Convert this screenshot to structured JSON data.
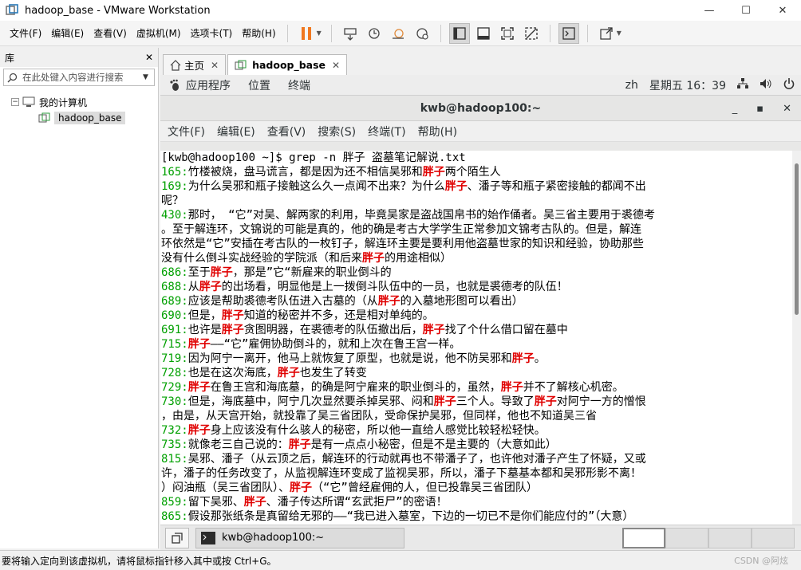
{
  "window": {
    "title": "hadoop_base - VMware Workstation"
  },
  "menu": [
    "文件(F)",
    "编辑(E)",
    "查看(V)",
    "虚拟机(M)",
    "选项卡(T)",
    "帮助(H)"
  ],
  "library": {
    "title": "库",
    "search_placeholder": "在此处键入内容进行搜索",
    "root": "我的计算机",
    "child": "hadoop_base"
  },
  "tabs": [
    {
      "label": "主页"
    },
    {
      "label": "hadoop_base"
    }
  ],
  "guest_bar": {
    "apps": "应用程序",
    "places": "位置",
    "terminal": "终端",
    "lang": "zh",
    "clock": "星期五 16：39"
  },
  "terminal": {
    "title": "kwb@hadoop100:~",
    "menu": [
      "文件(F)",
      "编辑(E)",
      "查看(V)",
      "搜索(S)",
      "终端(T)",
      "帮助(H)"
    ],
    "lines": [
      {
        "num": "",
        "segs": [
          {
            "t": "[kwb@hadoop100 ~]$ grep -n 胖子 盗墓笔记解说.txt"
          }
        ]
      },
      {
        "num": "165:",
        "segs": [
          {
            "t": "竹楼被烧，盘马谎言，都是因为还不相信吴邪和"
          },
          {
            "t": "胖子",
            "h": true
          },
          {
            "t": "两个陌生人"
          }
        ]
      },
      {
        "num": "169:",
        "segs": [
          {
            "t": "为什么吴邪和瓶子接触这么久一点闻不出来？为什么"
          },
          {
            "t": "胖子",
            "h": true
          },
          {
            "t": "、潘子等和瓶子紧密接触的都闻不出"
          }
        ]
      },
      {
        "num": "",
        "segs": [
          {
            "t": "呢？"
          }
        ]
      },
      {
        "num": "430:",
        "segs": [
          {
            "t": "那时，  “它”对吴、解两家的利用，毕竟吴家是盗战国帛书的始作俑者。吴三省主要用于裘德考"
          }
        ]
      },
      {
        "num": "",
        "segs": [
          {
            "t": "。至于解连环，文锦说的可能是真的，他的确是考古大学学生正常参加文锦考古队的。但是，解连"
          }
        ]
      },
      {
        "num": "",
        "segs": [
          {
            "t": "环依然是“它”安插在考古队的一枚钉子，解连环主要是要利用他盗墓世家的知识和经验，协助那些"
          }
        ]
      },
      {
        "num": "",
        "segs": [
          {
            "t": "没有什么倒斗实战经验的学院派（和后来"
          },
          {
            "t": "胖子",
            "h": true
          },
          {
            "t": "的用途相似）"
          }
        ]
      },
      {
        "num": "686:",
        "segs": [
          {
            "t": "至于"
          },
          {
            "t": "胖子",
            "h": true
          },
          {
            "t": "，那是”它“新雇来的职业倒斗的"
          }
        ]
      },
      {
        "num": "688:",
        "segs": [
          {
            "t": "从"
          },
          {
            "t": "胖子",
            "h": true
          },
          {
            "t": "的出场看，明显他是上一拨倒斗队伍中的一员，也就是裘德考的队伍！"
          }
        ]
      },
      {
        "num": "689:",
        "segs": [
          {
            "t": "应该是帮助裘德考队伍进入古墓的（从"
          },
          {
            "t": "胖子",
            "h": true
          },
          {
            "t": "的入墓地形图可以看出）"
          }
        ]
      },
      {
        "num": "690:",
        "segs": [
          {
            "t": "但是，"
          },
          {
            "t": "胖子",
            "h": true
          },
          {
            "t": "知道的秘密并不多，还是相对单纯的。"
          }
        ]
      },
      {
        "num": "691:",
        "segs": [
          {
            "t": "也许是"
          },
          {
            "t": "胖子",
            "h": true
          },
          {
            "t": "贪图明器，在裘德考的队伍撤出后，"
          },
          {
            "t": "胖子",
            "h": true
          },
          {
            "t": "找了个什么借口留在墓中"
          }
        ]
      },
      {
        "num": "715:",
        "segs": [
          {
            "t": "胖子",
            "h": true
          },
          {
            "t": "——“它”雇佣协助倒斗的，就和上次在鲁王宫一样。"
          }
        ]
      },
      {
        "num": "719:",
        "segs": [
          {
            "t": "因为阿宁一离开，他马上就恢复了原型，也就是说，他不防吴邪和"
          },
          {
            "t": "胖子",
            "h": true
          },
          {
            "t": "。"
          }
        ]
      },
      {
        "num": "728:",
        "segs": [
          {
            "t": "也是在这次海底，"
          },
          {
            "t": "胖子",
            "h": true
          },
          {
            "t": "也发生了转变"
          }
        ]
      },
      {
        "num": "729:",
        "segs": [
          {
            "t": "胖子",
            "h": true
          },
          {
            "t": "在鲁王宫和海底墓，的确是阿宁雇来的职业倒斗的，虽然，"
          },
          {
            "t": "胖子",
            "h": true
          },
          {
            "t": "并不了解核心机密。"
          }
        ]
      },
      {
        "num": "730:",
        "segs": [
          {
            "t": "但是，海底墓中，阿宁几次显然要杀掉吴邪、闷和"
          },
          {
            "t": "胖子",
            "h": true
          },
          {
            "t": "三个人。导致了"
          },
          {
            "t": "胖子",
            "h": true
          },
          {
            "t": "对阿宁一方的憎恨"
          }
        ]
      },
      {
        "num": "",
        "segs": [
          {
            "t": "，由是，从天宫开始，就投靠了吴三省团队，受命保护吴邪，但同样，他也不知道吴三省"
          }
        ]
      },
      {
        "num": "732:",
        "segs": [
          {
            "t": "胖子",
            "h": true
          },
          {
            "t": "身上应该没有什么骇人的秘密，所以他一直给人感觉比较轻松轻快。"
          }
        ]
      },
      {
        "num": "735:",
        "segs": [
          {
            "t": "就像老三自己说的："
          },
          {
            "t": "胖子",
            "h": true
          },
          {
            "t": "是有一点点小秘密，但是不是主要的（大意如此）"
          }
        ]
      },
      {
        "num": "815:",
        "segs": [
          {
            "t": "吴邪、潘子（从云顶之后，解连环的行动就再也不带潘子了，也许他对潘子产生了怀疑，又或"
          }
        ]
      },
      {
        "num": "",
        "segs": [
          {
            "t": "许，潘子的任务改变了，从监视解连环变成了监视吴邪，所以，潘子下墓基本都和吴邪形影不离！"
          }
        ]
      },
      {
        "num": "",
        "segs": [
          {
            "t": "）闷油瓶（吴三省团队）、"
          },
          {
            "t": "胖子",
            "h": true
          },
          {
            "t": "（“它”曾经雇佣的人，但已投靠吴三省团队）"
          }
        ]
      },
      {
        "num": "859:",
        "segs": [
          {
            "t": "留下吴邪、"
          },
          {
            "t": "胖子",
            "h": true
          },
          {
            "t": "、潘子传达所谓“玄武拒尸”的密语！"
          }
        ]
      },
      {
        "num": "865:",
        "segs": [
          {
            "t": "假设那张纸条是真留给无邪的——“我已进入墓室，下边的一切已不是你们能应付的”（大意）"
          }
        ]
      }
    ]
  },
  "taskbar": {
    "task_label": "kwb@hadoop100:~"
  },
  "status": {
    "hint": "要将输入定向到该虚拟机，请将鼠标指针移入其中或按 Ctrl+G。",
    "watermark": "CSDN @阿炫"
  }
}
